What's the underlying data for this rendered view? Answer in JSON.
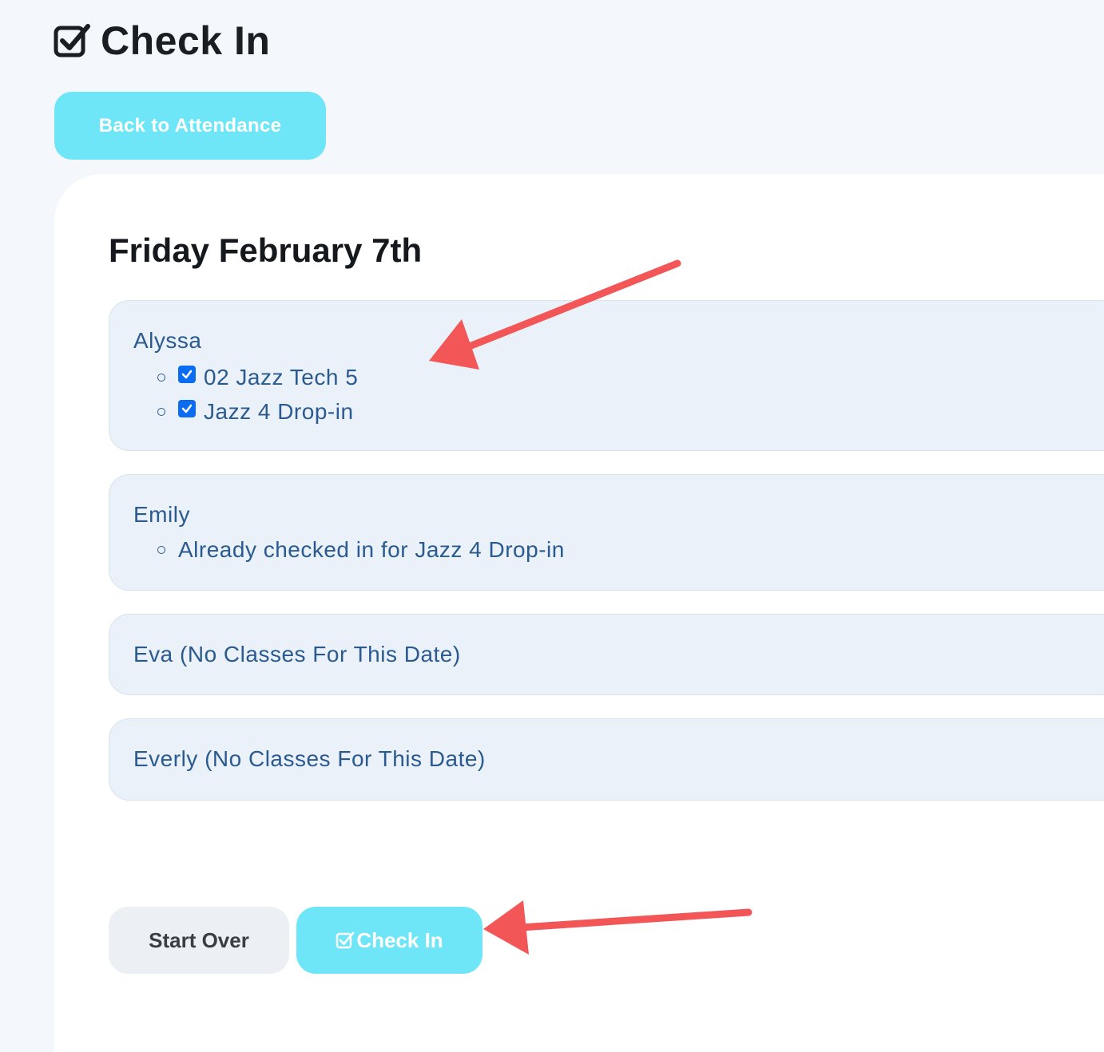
{
  "header": {
    "title": "Check In",
    "icon": "checkbox-checked-icon"
  },
  "back_button": {
    "label": "Back to Attendance"
  },
  "date_title": "Friday February 7th",
  "students": [
    {
      "name": "Alyssa",
      "classes": [
        {
          "label": "02 Jazz Tech 5",
          "checked": true
        },
        {
          "label": "Jazz 4 Drop-in",
          "checked": true
        }
      ]
    },
    {
      "name": "Emily",
      "note": "Already checked in for Jazz 4 Drop-in"
    },
    {
      "name": "Eva (No Classes For This Date)"
    },
    {
      "name": "Everly (No Classes For This Date)"
    }
  ],
  "actions": {
    "start_over_label": "Start Over",
    "check_in_label": "Check In",
    "check_in_icon": "checkbox-checked-icon"
  },
  "colors": {
    "accent": "#6ee6f8",
    "checkbox": "#0a6cf0",
    "student_text": "#2a5a90",
    "annotation_arrow": "#f25656"
  }
}
